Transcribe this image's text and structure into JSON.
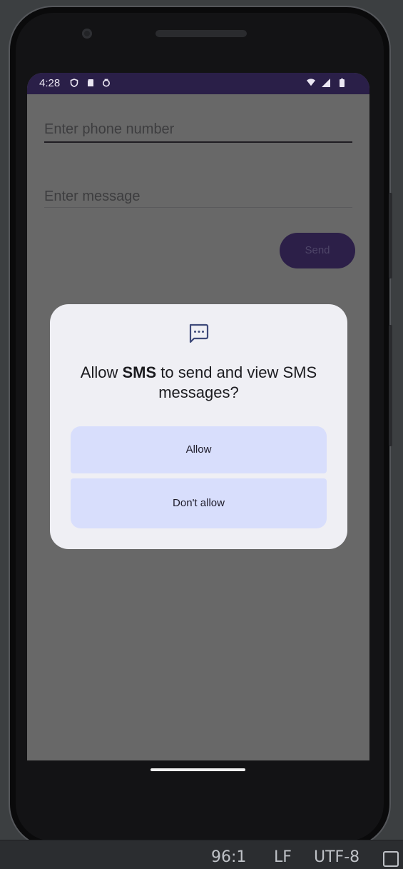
{
  "status_bar": {
    "time": "4:28"
  },
  "form": {
    "phone_placeholder": "Enter phone number",
    "message_placeholder": "Enter message",
    "send_label": "Send"
  },
  "dialog": {
    "title_prefix": "Allow ",
    "app_name": "SMS",
    "title_suffix": " to send and view SMS messages?",
    "allow_label": "Allow",
    "deny_label": "Don't allow"
  },
  "ide_status": {
    "position": "96:1",
    "line_ending": "LF",
    "encoding": "UTF-8"
  },
  "colors": {
    "status_bar_bg": "#2a1f48",
    "scrim": "#686868",
    "send_button_bg": "#2c1f48",
    "dialog_bg": "#efeff4",
    "dialog_button_bg": "#d8defc"
  },
  "icons": [
    "shield-icon",
    "sd-card-icon",
    "sync-icon",
    "wifi-icon",
    "signal-icon",
    "battery-icon",
    "sms-icon",
    "ide-toolwindow-icon"
  ]
}
